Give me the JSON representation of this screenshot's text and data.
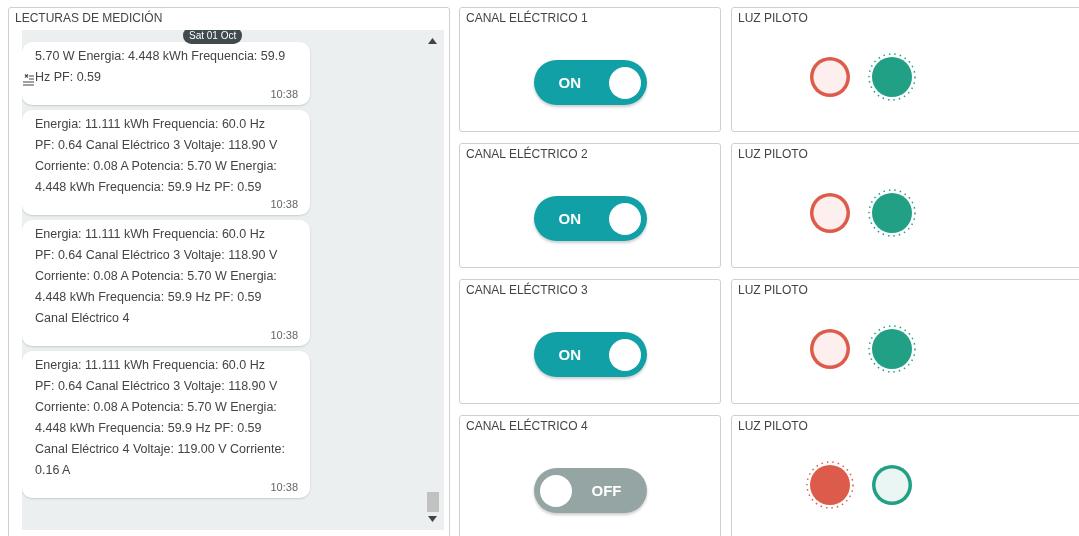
{
  "readings_panel": {
    "title": "LECTURAS DE MEDICIÓN",
    "date_badge": "Sat 01 Oct",
    "messages": [
      {
        "text": "5.70 W Energia: 4.448 kWh Frequencia: 59.9 Hz PF: 0.59",
        "time": "10:38"
      },
      {
        "text": "Energia: 11.111 kWh Frequencia: 60.0 Hz PF: 0.64 Canal Eléctrico 3 Voltaje: 118.90 V Corriente: 0.08 A Potencia: 5.70 W Energia: 4.448 kWh Frequencia: 59.9 Hz PF: 0.59",
        "time": "10:38"
      },
      {
        "text": "Energia: 11.111 kWh Frequencia: 60.0 Hz PF: 0.64 Canal Eléctrico 3 Voltaje: 118.90 V Corriente: 0.08 A Potencia: 5.70 W Energia: 4.448 kWh Frequencia: 59.9 Hz PF: 0.59 Canal Eléctrico 4",
        "time": "10:38"
      },
      {
        "text": "Energia: 11.111 kWh Frequencia: 60.0 Hz PF: 0.64 Canal Eléctrico 3 Voltaje: 118.90 V Corriente: 0.08 A Potencia: 5.70 W Energia: 4.448 kWh Frequencia: 59.9 Hz PF: 0.59 Canal Eléctrico 4 Voltaje: 119.00 V Corriente: 0.16 A",
        "time": "10:38"
      }
    ]
  },
  "channels": [
    {
      "title": "CANAL ELÉCTRICO 1",
      "switch": {
        "on": true,
        "label": "ON"
      },
      "pilot": {
        "title": "LUZ PILOTO",
        "lights": [
          {
            "color": "#dd5b4b",
            "on": false
          },
          {
            "color": "#21a086",
            "on": true
          }
        ]
      }
    },
    {
      "title": "CANAL ELÉCTRICO 2",
      "switch": {
        "on": true,
        "label": "ON"
      },
      "pilot": {
        "title": "LUZ PILOTO",
        "lights": [
          {
            "color": "#dd5b4b",
            "on": false
          },
          {
            "color": "#21a086",
            "on": true
          }
        ]
      }
    },
    {
      "title": "CANAL ELÉCTRICO 3",
      "switch": {
        "on": true,
        "label": "ON"
      },
      "pilot": {
        "title": "LUZ PILOTO",
        "lights": [
          {
            "color": "#dd5b4b",
            "on": false
          },
          {
            "color": "#21a086",
            "on": true
          }
        ]
      }
    },
    {
      "title": "CANAL ELÉCTRICO 4",
      "switch": {
        "on": false,
        "label": "OFF"
      },
      "pilot": {
        "title": "LUZ PILOTO",
        "lights": [
          {
            "color": "#dd5b4b",
            "on": true
          },
          {
            "color": "#21a086",
            "on": false
          }
        ]
      }
    }
  ]
}
